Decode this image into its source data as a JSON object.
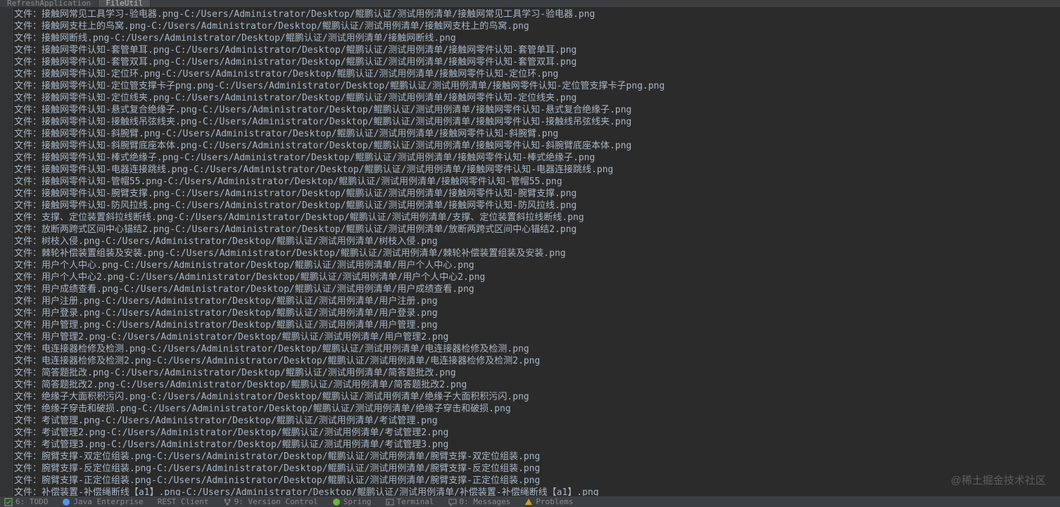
{
  "tabs": [
    {
      "label": "RefreshApplication"
    },
    {
      "label": "FileUtil"
    }
  ],
  "lines": [
    "文件：接触网常见工具学习-验电器.png-C:/Users/Administrator/Desktop/鲲鹏认证/测试用例清单/接触网常见工具学习-验电器.png",
    "文件：接触网支柱上的鸟窝.png-C:/Users/Administrator/Desktop/鲲鹏认证/测试用例清单/接触网支柱上的鸟窝.png",
    "文件：接触网断线.png-C:/Users/Administrator/Desktop/鲲鹏认证/测试用例清单/接触网断线.png",
    "文件：接触网零件认知-套管单耳.png-C:/Users/Administrator/Desktop/鲲鹏认证/测试用例清单/接触网零件认知-套管单耳.png",
    "文件：接触网零件认知-套管双耳.png-C:/Users/Administrator/Desktop/鲲鹏认证/测试用例清单/接触网零件认知-套管双耳.png",
    "文件：接触网零件认知-定位环.png-C:/Users/Administrator/Desktop/鲲鹏认证/测试用例清单/接触网零件认知-定位环.png",
    "文件：接触网零件认知-定位管支撑卡子png.png-C:/Users/Administrator/Desktop/鲲鹏认证/测试用例清单/接触网零件认知-定位管支撑卡子png.png",
    "文件：接触网零件认知-定位线夹.png-C:/Users/Administrator/Desktop/鲲鹏认证/测试用例清单/接触网零件认知-定位线夹.png",
    "文件：接触网零件认知-悬式复合绝缘子.png-C:/Users/Administrator/Desktop/鲲鹏认证/测试用例清单/接触网零件认知-悬式复合绝缘子.png",
    "文件：接触网零件认知-接触线吊弦线夹.png-C:/Users/Administrator/Desktop/鲲鹏认证/测试用例清单/接触网零件认知-接触线吊弦线夹.png",
    "文件：接触网零件认知-斜腕臂.png-C:/Users/Administrator/Desktop/鲲鹏认证/测试用例清单/接触网零件认知-斜腕臂.png",
    "文件：接触网零件认知-斜腕臂底座本体.png-C:/Users/Administrator/Desktop/鲲鹏认证/测试用例清单/接触网零件认知-斜腕臂底座本体.png",
    "文件：接触网零件认知-棒式绝缘子.png-C:/Users/Administrator/Desktop/鲲鹏认证/测试用例清单/接触网零件认知-棒式绝缘子.png",
    "文件：接触网零件认知-电器连接跳线.png-C:/Users/Administrator/Desktop/鲲鹏认证/测试用例清单/接触网零件认知-电器连接跳线.png",
    "文件：接触网零件认知-管帽55.png-C:/Users/Administrator/Desktop/鲲鹏认证/测试用例清单/接触网零件认知-管帽55.png",
    "文件：接触网零件认知-腕臂支撑.png-C:/Users/Administrator/Desktop/鲲鹏认证/测试用例清单/接触网零件认知-腕臂支撑.png",
    "文件：接触网零件认知-防风拉线.png-C:/Users/Administrator/Desktop/鲲鹏认证/测试用例清单/接触网零件认知-防风拉线.png",
    "文件：支撑、定位装置斜拉线断线.png-C:/Users/Administrator/Desktop/鲲鹏认证/测试用例清单/支撑、定位装置斜拉线断线.png",
    "文件：放断两跨式区间中心锚结2.png-C:/Users/Administrator/Desktop/鲲鹏认证/测试用例清单/放断两跨式区间中心锚结2.png",
    "文件：树枝入侵.png-C:/Users/Administrator/Desktop/鲲鹏认证/测试用例清单/树枝入侵.png",
    "文件：棘轮补偿装置组装及安装.png-C:/Users/Administrator/Desktop/鲲鹏认证/测试用例清单/棘轮补偿装置组装及安装.png",
    "文件：用户个人中心.png-C:/Users/Administrator/Desktop/鲲鹏认证/测试用例清单/用户个人中心.png",
    "文件：用户个人中心2.png-C:/Users/Administrator/Desktop/鲲鹏认证/测试用例清单/用户个人中心2.png",
    "文件：用户成绩查看.png-C:/Users/Administrator/Desktop/鲲鹏认证/测试用例清单/用户成绩查看.png",
    "文件：用户注册.png-C:/Users/Administrator/Desktop/鲲鹏认证/测试用例清单/用户注册.png",
    "文件：用户登录.png-C:/Users/Administrator/Desktop/鲲鹏认证/测试用例清单/用户登录.png",
    "文件：用户管理.png-C:/Users/Administrator/Desktop/鲲鹏认证/测试用例清单/用户管理.png",
    "文件：用户管理2.png-C:/Users/Administrator/Desktop/鲲鹏认证/测试用例清单/用户管理2.png",
    "文件：电连接器检修及检测.png-C:/Users/Administrator/Desktop/鲲鹏认证/测试用例清单/电连接器检修及检测.png",
    "文件：电连接器检修及检测2.png-C:/Users/Administrator/Desktop/鲲鹏认证/测试用例清单/电连接器检修及检测2.png",
    "文件：简答题批改.png-C:/Users/Administrator/Desktop/鲲鹏认证/测试用例清单/简答题批改.png",
    "文件：简答题批改2.png-C:/Users/Administrator/Desktop/鲲鹏认证/测试用例清单/简答题批改2.png",
    "文件：绝缘子大面积积污闪.png-C:/Users/Administrator/Desktop/鲲鹏认证/测试用例清单/绝缘子大面积积污闪.png",
    "文件：绝缘子穿击和破损.png-C:/Users/Administrator/Desktop/鲲鹏认证/测试用例清单/绝缘子穿击和破损.png",
    "文件：考试管理.png-C:/Users/Administrator/Desktop/鲲鹏认证/测试用例清单/考试管理.png",
    "文件：考试管理2.png-C:/Users/Administrator/Desktop/鲲鹏认证/测试用例清单/考试管理2.png",
    "文件：考试管理3.png-C:/Users/Administrator/Desktop/鲲鹏认证/测试用例清单/考试管理3.png",
    "文件：腕臂支撑-双定位组装.png-C:/Users/Administrator/Desktop/鲲鹏认证/测试用例清单/腕臂支撑-双定位组装.png",
    "文件：腕臂支撑-反定位组装.png-C:/Users/Administrator/Desktop/鲲鹏认证/测试用例清单/腕臂支撑-反定位组装.png",
    "文件：腕臂支撑-正定位组装.png-C:/Users/Administrator/Desktop/鲲鹏认证/测试用例清单/腕臂支撑-正定位组装.png",
    "文件：补偿装置-补偿绳断线【a1】.png-C:/Users/Administrator/Desktop/鲲鹏认证/测试用例清单/补偿装置-补偿绳断线【a1】.png"
  ],
  "bottomBar": {
    "todo": "6: TODO",
    "javaEnterprise": "Java Enterprise",
    "restClient": "REST Client",
    "versionControl": "9: Version Control",
    "spring": "Spring",
    "terminal": "Terminal",
    "messages": "0: Messages",
    "problems": "Problems"
  },
  "watermark": "@稀土掘金技术社区"
}
